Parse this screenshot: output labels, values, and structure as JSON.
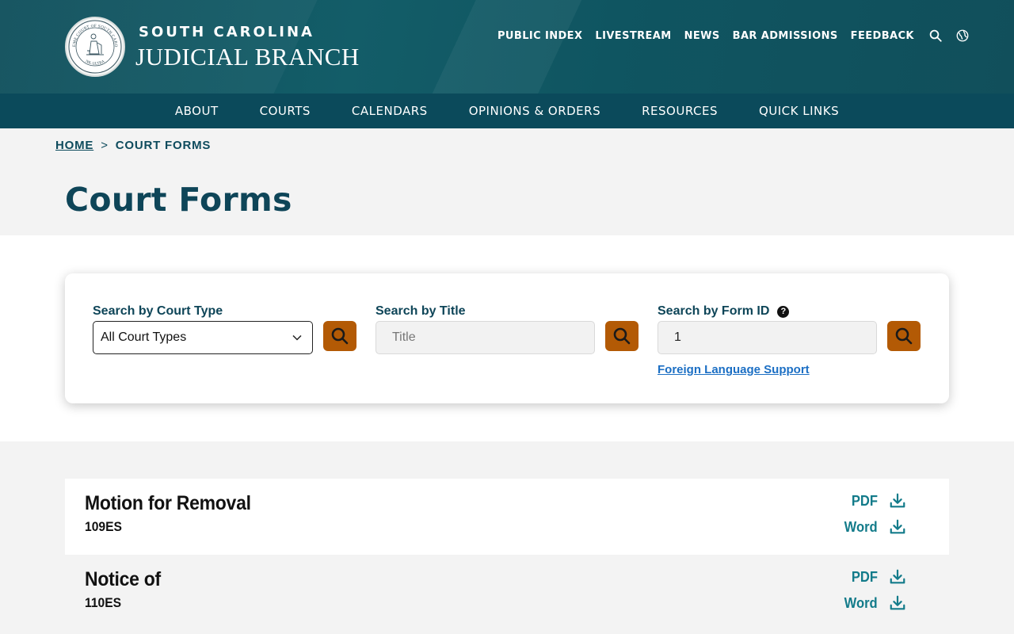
{
  "header": {
    "seal_alt": "Supreme Court of South Carolina seal",
    "seal_text_top": "SUPREME COURT OF SOUTH CAROLINA",
    "seal_text_bottom": "NIL ULTRA",
    "brand_line1": "SOUTH CAROLINA",
    "brand_line2": "JUDICIAL BRANCH",
    "util_links": [
      "PUBLIC INDEX",
      "LIVESTREAM",
      "NEWS",
      "BAR ADMISSIONS",
      "FEEDBACK"
    ],
    "icons": [
      "search-icon",
      "globe-icon"
    ]
  },
  "nav": {
    "items": [
      "ABOUT",
      "COURTS",
      "CALENDARS",
      "OPINIONS & ORDERS",
      "RESOURCES",
      "QUICK LINKS"
    ]
  },
  "breadcrumb": {
    "home": "HOME",
    "separator": ">",
    "current": "COURT FORMS"
  },
  "page": {
    "title": "Court Forms"
  },
  "search": {
    "court_type_label": "Search by Court Type",
    "court_type_value": "All Court Types",
    "title_label": "Search by Title",
    "title_placeholder": "Title",
    "title_value": "",
    "form_id_label": "Search by Form ID",
    "form_id_help": "?",
    "form_id_value": "1",
    "foreign_language_link": "Foreign Language Support"
  },
  "results": [
    {
      "title": "Motion for Removal",
      "id": "109ES",
      "pdf_label": "PDF",
      "word_label": "Word"
    },
    {
      "title": "Notice of",
      "id": "110ES",
      "pdf_label": "PDF",
      "word_label": "Word"
    }
  ],
  "colors": {
    "header_teal": "#135d68",
    "nav_teal": "#0b4a5b",
    "title_navy": "#0e4558",
    "button_orange": "#b35a05",
    "download_teal": "#137b8a",
    "link_blue": "#1c6fc4"
  }
}
